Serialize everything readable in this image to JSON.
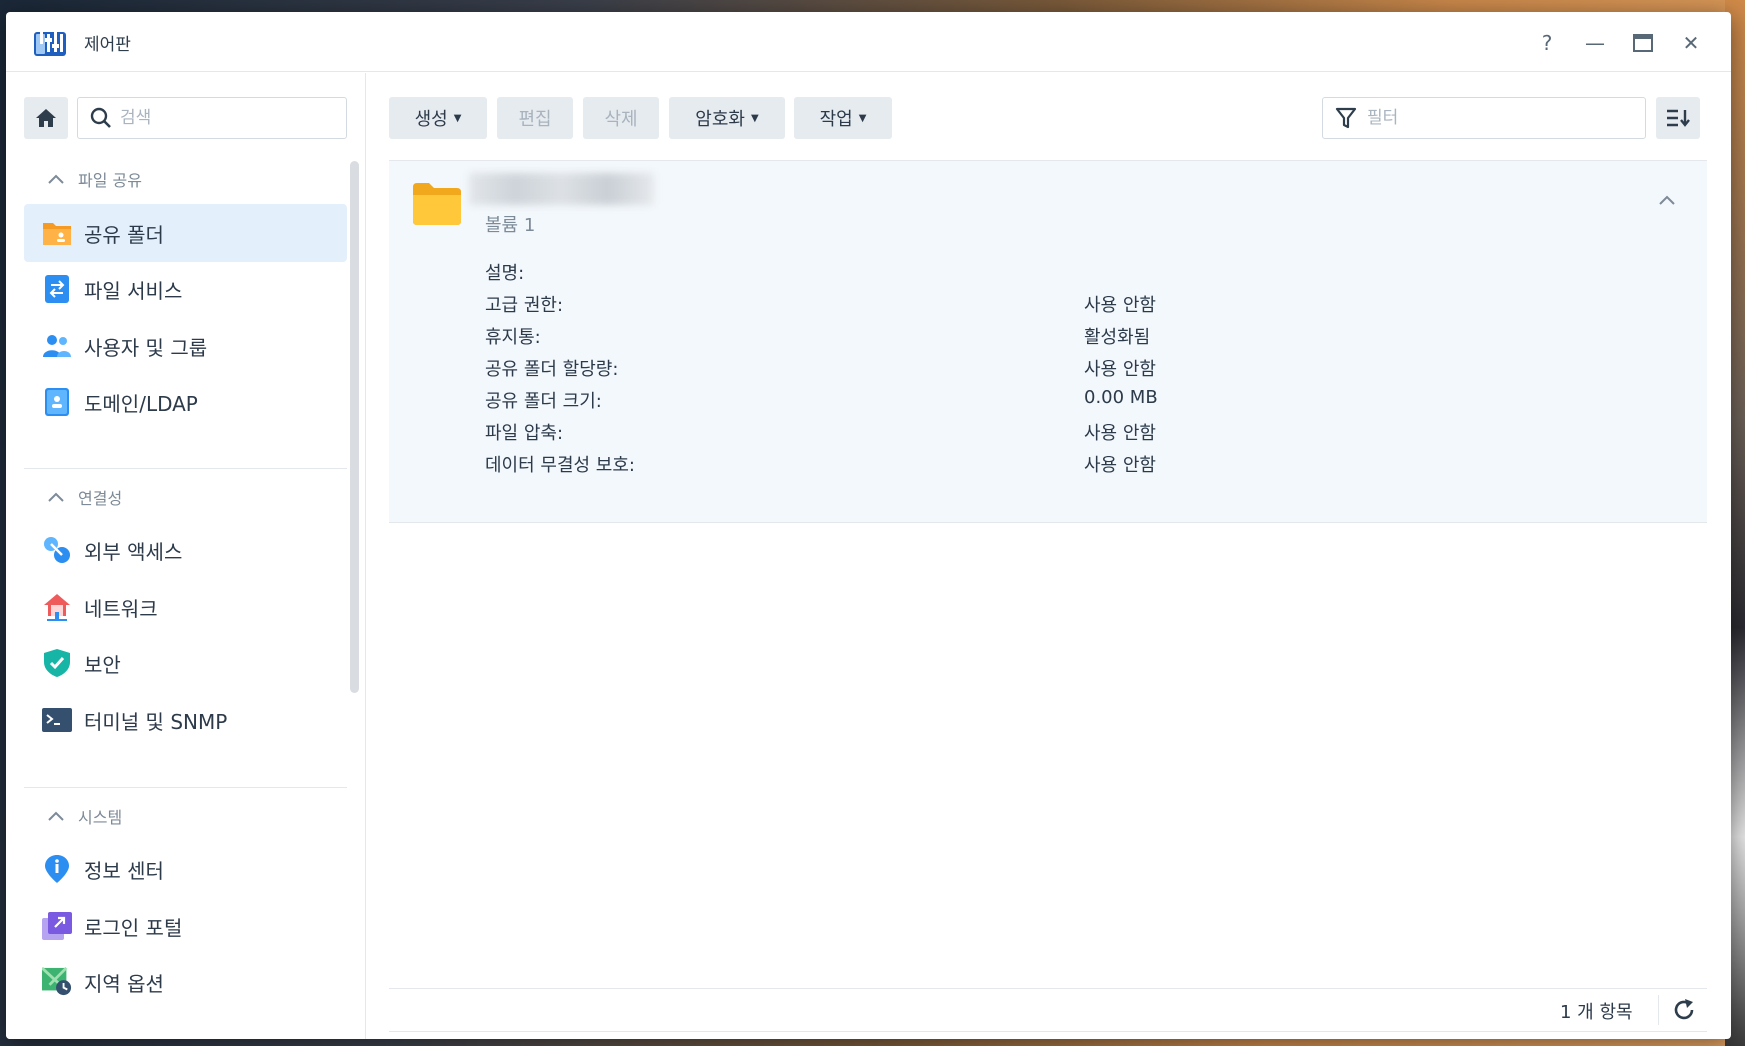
{
  "window": {
    "title": "제어판"
  },
  "controls": {
    "help": "?",
    "minimize": "—",
    "maximize": "▭",
    "close": "✕"
  },
  "sidebar": {
    "search_placeholder": "검색",
    "sections": [
      {
        "label": "파일 공유",
        "items": [
          {
            "label": "공유 폴더",
            "icon": "shared-folder-icon",
            "active": true
          },
          {
            "label": "파일 서비스",
            "icon": "file-services-icon"
          },
          {
            "label": "사용자 및 그룹",
            "icon": "users-groups-icon"
          },
          {
            "label": "도메인/LDAP",
            "icon": "domain-ldap-icon"
          }
        ]
      },
      {
        "label": "연결성",
        "items": [
          {
            "label": "외부 액세스",
            "icon": "external-access-icon"
          },
          {
            "label": "네트워크",
            "icon": "network-icon"
          },
          {
            "label": "보안",
            "icon": "security-shield-icon"
          },
          {
            "label": "터미널 및 SNMP",
            "icon": "terminal-icon"
          }
        ]
      },
      {
        "label": "시스템",
        "items": [
          {
            "label": "정보 센터",
            "icon": "info-center-icon"
          },
          {
            "label": "로그인 포털",
            "icon": "login-portal-icon"
          },
          {
            "label": "지역 옵션",
            "icon": "regional-options-icon"
          }
        ]
      }
    ]
  },
  "toolbar": {
    "create": "생성",
    "edit": "편집",
    "delete": "삭제",
    "encryption": "암호화",
    "action": "작업",
    "filter_placeholder": "필터"
  },
  "folder": {
    "name": "",
    "volume": "볼륨 1",
    "properties": [
      {
        "label": "설명:",
        "value": ""
      },
      {
        "label": "고급 권한:",
        "value": "사용 안함"
      },
      {
        "label": "휴지통:",
        "value": "활성화됨"
      },
      {
        "label": "공유 폴더 할당량:",
        "value": "사용 안함"
      },
      {
        "label": "공유 폴더 크기:",
        "value": "0.00 MB"
      },
      {
        "label": "파일 압축:",
        "value": "사용 안함"
      },
      {
        "label": "데이터 무결성 보호:",
        "value": "사용 안함"
      }
    ]
  },
  "footer": {
    "item_count": "1 개 항목"
  },
  "colors": {
    "accent": "#0a7ae0",
    "active_bg": "#e3f0fc",
    "button_bg": "#e6ebf0",
    "folder": "#ffc83a"
  }
}
